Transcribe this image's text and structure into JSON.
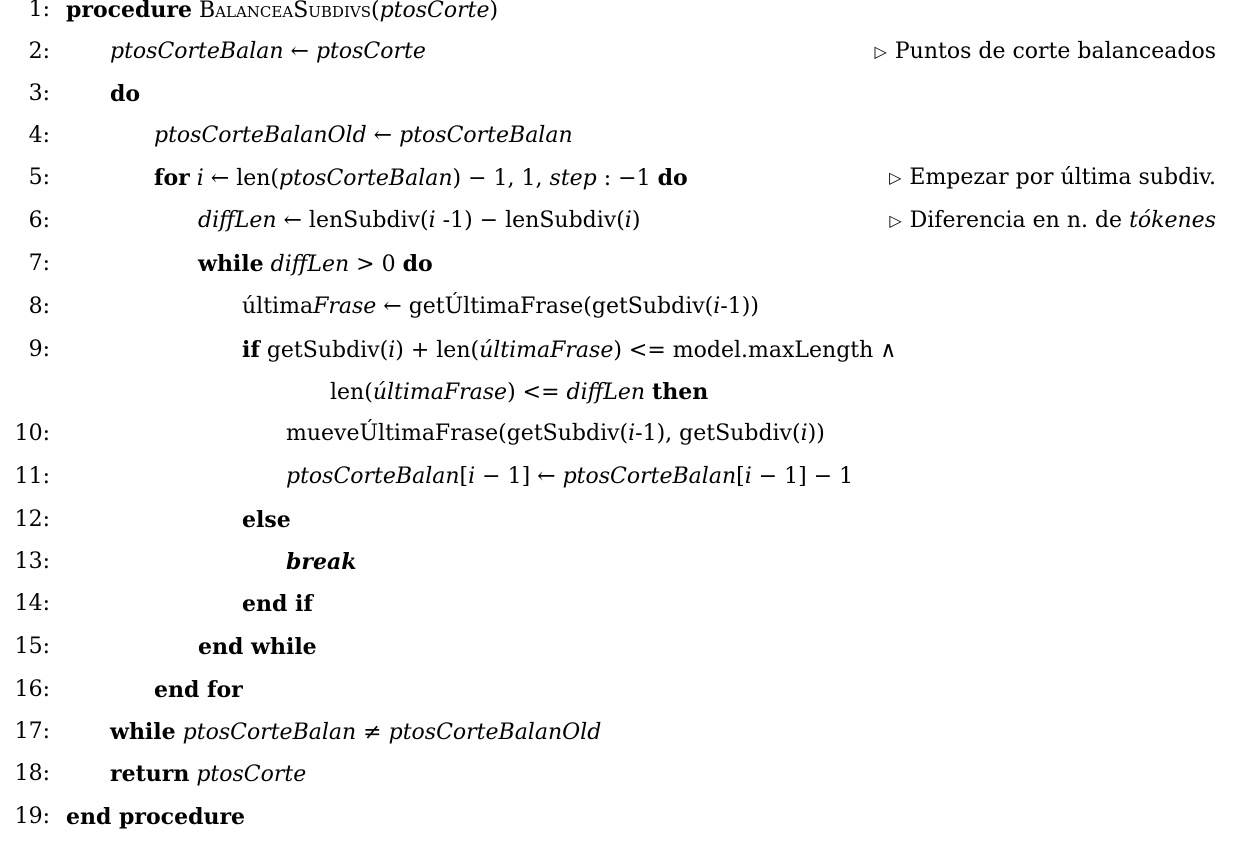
{
  "algorithm": {
    "lines": [
      {
        "num": "1:",
        "parts": [
          {
            "t": "procedure",
            "s": "kw"
          },
          {
            "t": " ",
            "s": ""
          },
          {
            "t": "BalanceaSubdivs",
            "s": "sc"
          },
          {
            "t": "(",
            "s": ""
          },
          {
            "t": "ptosCorte",
            "s": "it"
          },
          {
            "t": ")",
            "s": ""
          }
        ],
        "comment": []
      },
      {
        "num": "2:",
        "parts": [
          {
            "t": "ptosCorteBalan",
            "s": "it"
          },
          {
            "t": " ← ",
            "s": ""
          },
          {
            "t": "ptosCorte",
            "s": "it"
          }
        ],
        "comment": [
          {
            "t": "Puntos de corte balanceados",
            "s": ""
          }
        ]
      },
      {
        "num": "3:",
        "parts": [
          {
            "t": "do",
            "s": "kw"
          }
        ],
        "comment": []
      },
      {
        "num": "4:",
        "parts": [
          {
            "t": "ptosCorteBalanOld",
            "s": "it"
          },
          {
            "t": " ← ",
            "s": ""
          },
          {
            "t": "ptosCorteBalan",
            "s": "it"
          }
        ],
        "comment": []
      },
      {
        "num": "5:",
        "parts": [
          {
            "t": "for",
            "s": "kw"
          },
          {
            "t": " ",
            "s": ""
          },
          {
            "t": "i",
            "s": "it"
          },
          {
            "t": " ← len(",
            "s": ""
          },
          {
            "t": "ptosCorteBalan",
            "s": "it"
          },
          {
            "t": ") − 1, 1, ",
            "s": ""
          },
          {
            "t": "step",
            "s": "it"
          },
          {
            "t": " : −1  ",
            "s": ""
          },
          {
            "t": "do",
            "s": "kw"
          }
        ],
        "comment": [
          {
            "t": "Empezar por última subdiv.",
            "s": ""
          }
        ]
      },
      {
        "num": "6:",
        "parts": [
          {
            "t": "diffLen",
            "s": "it"
          },
          {
            "t": " ← lenSubdiv(",
            "s": ""
          },
          {
            "t": "i",
            "s": "it"
          },
          {
            "t": " -1) − lenSubdiv(",
            "s": ""
          },
          {
            "t": "i",
            "s": "it"
          },
          {
            "t": ")",
            "s": ""
          }
        ],
        "comment": [
          {
            "t": "Diferencia en n. de ",
            "s": ""
          },
          {
            "t": "tókenes",
            "s": "it"
          }
        ]
      },
      {
        "num": "7:",
        "parts": [
          {
            "t": "while",
            "s": "kw"
          },
          {
            "t": " ",
            "s": ""
          },
          {
            "t": "diffLen",
            "s": "it"
          },
          {
            "t": " > 0  ",
            "s": ""
          },
          {
            "t": "do",
            "s": "kw"
          }
        ],
        "comment": []
      },
      {
        "num": "8:",
        "parts": [
          {
            "t": "última",
            "s": ""
          },
          {
            "t": "Frase",
            "s": "it"
          },
          {
            "t": " ← getÚltimaFrase(getSubdiv(",
            "s": ""
          },
          {
            "t": "i",
            "s": "it"
          },
          {
            "t": "-1))",
            "s": ""
          }
        ],
        "comment": []
      },
      {
        "num": "9:",
        "parts": [
          {
            "t": "if",
            "s": "kw"
          },
          {
            "t": " getSubdiv(",
            "s": ""
          },
          {
            "t": "i",
            "s": "it"
          },
          {
            "t": ") + len(",
            "s": ""
          },
          {
            "t": "últimaFrase",
            "s": "it"
          },
          {
            "t": ") <= model.maxLength  ∧",
            "s": ""
          }
        ],
        "comment": []
      },
      {
        "num": "",
        "parts": [
          {
            "t": "len(",
            "s": ""
          },
          {
            "t": "últimaFrase",
            "s": "it"
          },
          {
            "t": ") <= ",
            "s": ""
          },
          {
            "t": "diffLen",
            "s": "it"
          },
          {
            "t": "  ",
            "s": ""
          },
          {
            "t": "then",
            "s": "kw"
          }
        ],
        "comment": []
      },
      {
        "num": "10:",
        "parts": [
          {
            "t": "mueveÚltimaFrase(getSubdiv(",
            "s": ""
          },
          {
            "t": "i",
            "s": "it"
          },
          {
            "t": "-1), getSubdiv(",
            "s": ""
          },
          {
            "t": "i",
            "s": "it"
          },
          {
            "t": "))",
            "s": ""
          }
        ],
        "comment": []
      },
      {
        "num": "11:",
        "parts": [
          {
            "t": "ptosCorteBalan",
            "s": "it"
          },
          {
            "t": "[",
            "s": ""
          },
          {
            "t": "i",
            "s": "it"
          },
          {
            "t": " − 1] ← ",
            "s": ""
          },
          {
            "t": "ptosCorteBalan",
            "s": "it"
          },
          {
            "t": "[",
            "s": ""
          },
          {
            "t": "i",
            "s": "it"
          },
          {
            "t": " − 1] − 1",
            "s": ""
          }
        ],
        "comment": []
      },
      {
        "num": "12:",
        "parts": [
          {
            "t": "else",
            "s": "kw"
          }
        ],
        "comment": []
      },
      {
        "num": "13:",
        "parts": [
          {
            "t": "break",
            "s": "bi"
          }
        ],
        "comment": []
      },
      {
        "num": "14:",
        "parts": [
          {
            "t": "end if",
            "s": "kw"
          }
        ],
        "comment": []
      },
      {
        "num": "15:",
        "parts": [
          {
            "t": "end while",
            "s": "kw"
          }
        ],
        "comment": []
      },
      {
        "num": "16:",
        "parts": [
          {
            "t": "end for",
            "s": "kw"
          }
        ],
        "comment": []
      },
      {
        "num": "17:",
        "parts": [
          {
            "t": "while",
            "s": "kw"
          },
          {
            "t": " ",
            "s": ""
          },
          {
            "t": "ptosCorteBalan",
            "s": "it"
          },
          {
            "t": " ≠ ",
            "s": ""
          },
          {
            "t": "ptosCorteBalanOld",
            "s": "it"
          }
        ],
        "comment": []
      },
      {
        "num": "18:",
        "parts": [
          {
            "t": "return",
            "s": "kw"
          },
          {
            "t": " ",
            "s": ""
          },
          {
            "t": "ptosCorte",
            "s": "it"
          }
        ],
        "comment": []
      },
      {
        "num": "19:",
        "parts": [
          {
            "t": "end procedure",
            "s": "kw"
          }
        ],
        "comment": []
      }
    ],
    "comment_marker": "▷"
  }
}
